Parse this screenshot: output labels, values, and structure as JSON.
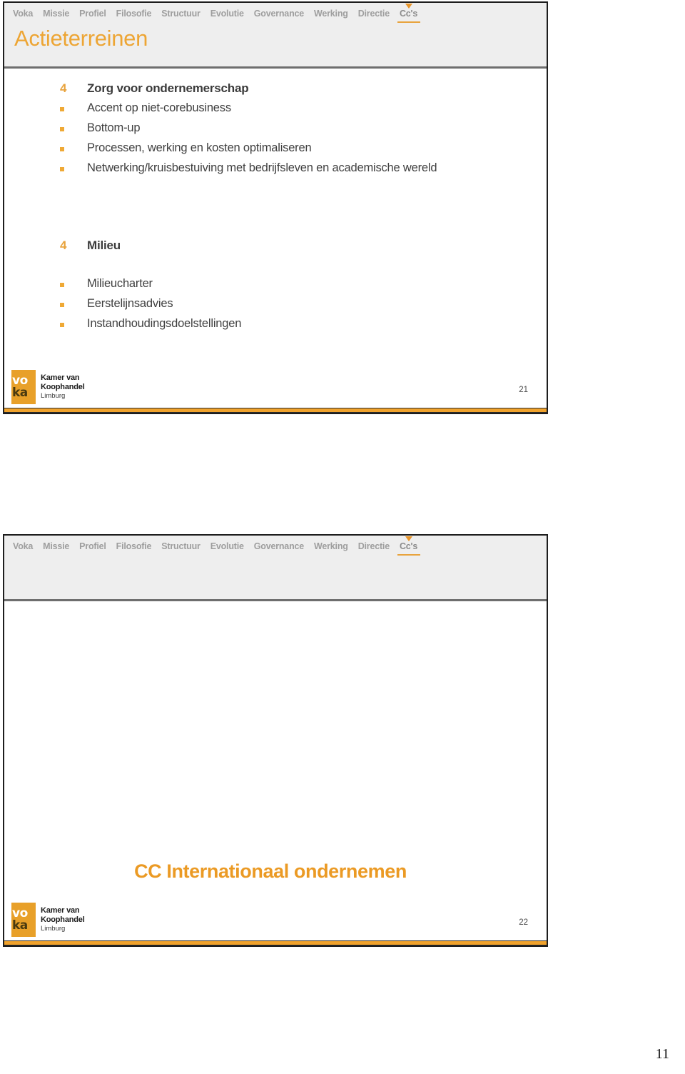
{
  "document": {
    "page_number": "11"
  },
  "nav": {
    "items": [
      {
        "label": "Voka",
        "active": false
      },
      {
        "label": "Missie",
        "active": false
      },
      {
        "label": "Profiel",
        "active": false
      },
      {
        "label": "Filosofie",
        "active": false
      },
      {
        "label": "Structuur",
        "active": false
      },
      {
        "label": "Evolutie",
        "active": false
      },
      {
        "label": "Governance",
        "active": false
      },
      {
        "label": "Werking",
        "active": false
      },
      {
        "label": "Directie",
        "active": false
      },
      {
        "label": "Cc's",
        "active": true
      }
    ]
  },
  "logo": {
    "mark_line1": "vo",
    "mark_line2": "ka",
    "line1": "Kamer van",
    "line2": "Koophandel",
    "line3": "Limburg"
  },
  "colors": {
    "accent_orange": "#eda534",
    "bullet_orange": "#efa935",
    "header_gray": "#eeeeee",
    "text_dark": "#3b3b3b",
    "nav_gray": "#9e9e9e"
  },
  "slides": [
    {
      "title": "Actieterreinen",
      "page_label": "21",
      "blocks": [
        {
          "number": "4",
          "heading": "Zorg voor ondernemerschap",
          "bullets": [
            "Accent op niet-corebusiness",
            "Bottom-up",
            "Processen, werking en kosten optimaliseren",
            "Netwerking/kruisbestuiving met bedrijfsleven en academische wereld"
          ]
        },
        {
          "number": "4",
          "heading": "Milieu",
          "bullets": [
            "Milieucharter",
            "Eerstelijnsadvies",
            "Instandhoudingsdoelstellingen"
          ]
        }
      ]
    },
    {
      "title": "",
      "page_label": "22",
      "center_title": "CC Internationaal ondernemen"
    }
  ]
}
